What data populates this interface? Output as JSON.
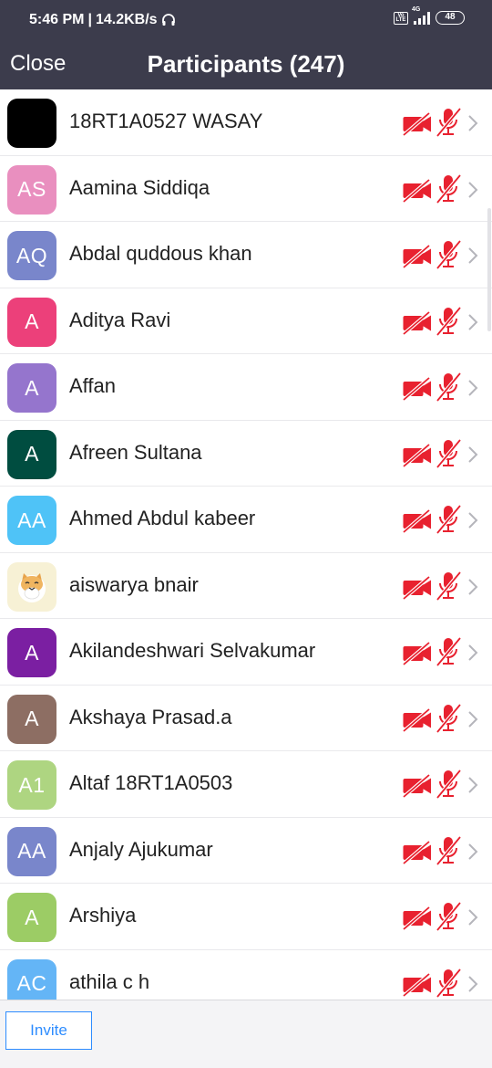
{
  "status_bar": {
    "time": "5:46 PM",
    "separator": "|",
    "speed": "14.2KB/s",
    "network_tag": "4G",
    "volte": "Vo LTE",
    "battery": "48"
  },
  "header": {
    "close_label": "Close",
    "title": "Participants (247)"
  },
  "participants": [
    {
      "initials": "",
      "name": "18RT1A0527 WASAY",
      "color": "#000000"
    },
    {
      "initials": "AS",
      "name": "Aamina Siddiqa",
      "color": "#e98fbf"
    },
    {
      "initials": "AQ",
      "name": "Abdal quddous khan",
      "color": "#7986cb"
    },
    {
      "initials": "A",
      "name": "Aditya Ravi",
      "color": "#ec407a"
    },
    {
      "initials": "A",
      "name": "Affan",
      "color": "#9575cd"
    },
    {
      "initials": "A",
      "name": "Afreen Sultana",
      "color": "#004d40"
    },
    {
      "initials": "AA",
      "name": "Ahmed Abdul kabeer",
      "color": "#4fc3f7"
    },
    {
      "initials": "",
      "name": "aiswarya bnair",
      "color": "#f7f1d5",
      "avatar_icon": "cat-face-icon"
    },
    {
      "initials": "A",
      "name": "Akilandeshwari Selvakumar",
      "color": "#7b1fa2"
    },
    {
      "initials": "A",
      "name": "Akshaya Prasad.a",
      "color": "#8d6e63"
    },
    {
      "initials": "A1",
      "name": "Altaf 18RT1A0503",
      "color": "#aed581"
    },
    {
      "initials": "AA",
      "name": "Anjaly Ajukumar",
      "color": "#7986cb"
    },
    {
      "initials": "A",
      "name": "Arshiya",
      "color": "#9ccc65"
    },
    {
      "initials": "AC",
      "name": "athila c h",
      "color": "#64b5f6"
    }
  ],
  "footer": {
    "invite_label": "Invite"
  },
  "colors": {
    "header_bg": "#3c3c4c",
    "muted_red": "#e8212f",
    "accent_blue": "#2d8cff"
  },
  "icons": {
    "video": "video-off-icon",
    "mic": "mic-off-icon",
    "chevron": "chevron-right-icon"
  }
}
